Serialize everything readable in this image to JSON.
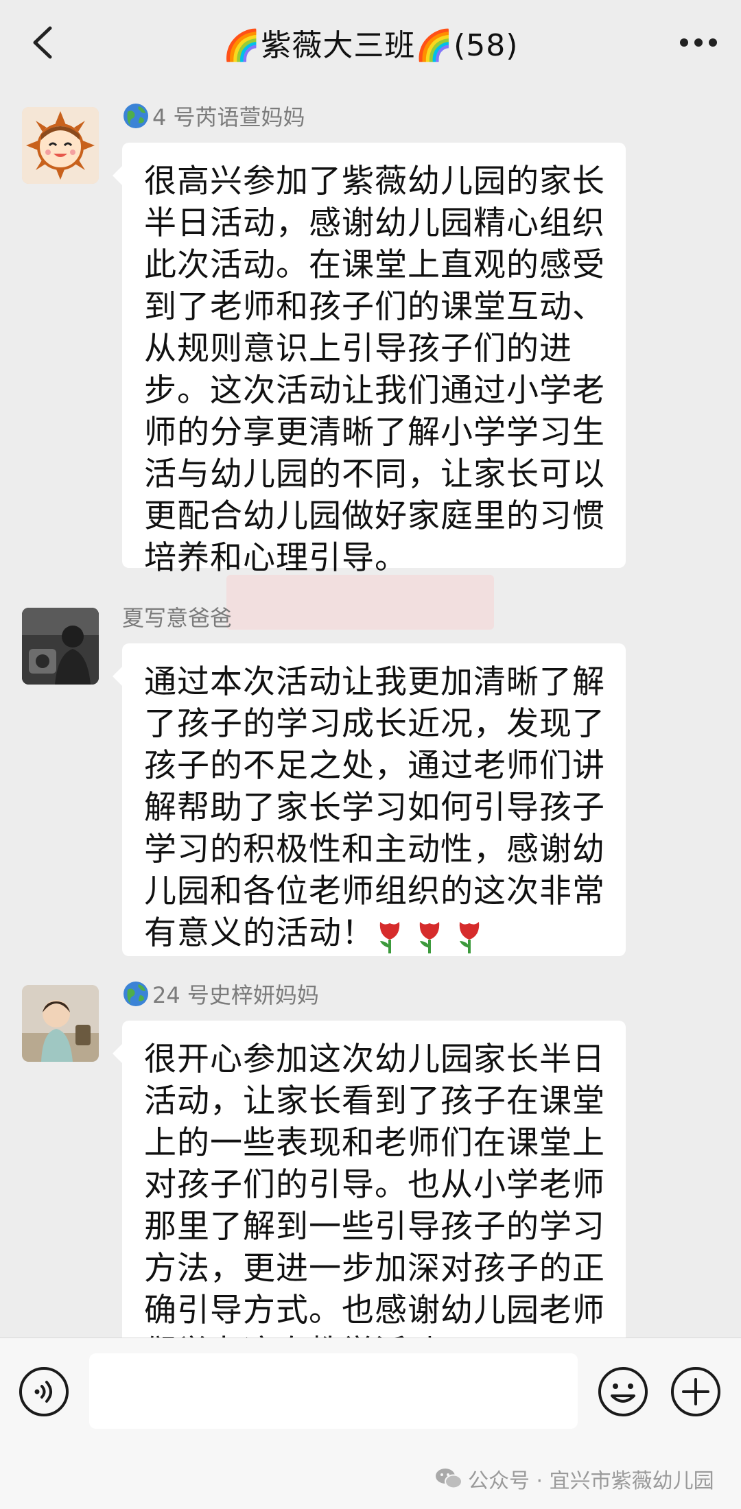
{
  "header": {
    "title": "🌈紫薇大三班🌈(58)"
  },
  "messages": [
    {
      "sender": "4 号芮语萱妈妈",
      "text": "很高兴参加了紫薇幼儿园的家长半日活动，感谢幼儿园精心组织此次活动。在课堂上直观的感受到了老师和孩子们的课堂互动、从规则意识上引导孩子们的进步。这次活动让我们通过小学老师的分享更清晰了解小学学习生活与幼儿园的不同，让家长可以更配合幼儿园做好家庭里的习惯培养和心理引导。"
    },
    {
      "sender": "夏写意爸爸",
      "text": "通过本次活动让我更加清晰了解了孩子的学习成长近况，发现了孩子的不足之处，通过老师们讲解帮助了家长学习如何引导孩子学习的积极性和主动性，感谢幼儿园和各位老师组织的这次非常有意义的活动！"
    },
    {
      "sender": "24 号史梓妍妈妈",
      "text": "很开心参加这次幼儿园家长半日活动，让家长看到了孩子在课堂上的一些表现和老师们在课堂上对孩子们的引导。也从小学老师那里了解到一些引导孩子的学习方法，更进一步加深对孩子的正确引导方式。也感谢幼儿园老师们举办这次教学活动！！"
    }
  ],
  "icons": {
    "back": "chevron-left-icon",
    "more": "more-dots-icon",
    "voice": "voice-icon",
    "emoji": "emoji-icon",
    "plus": "plus-circle-icon",
    "globe": "globe-icon",
    "tulip": "tulip-icon",
    "wechat": "wechat-icon"
  },
  "input": {
    "value": "",
    "placeholder": ""
  },
  "watermark": {
    "text": "公众号 · 宜兴市紫薇幼儿园"
  },
  "colors": {
    "background": "#ededed",
    "bubble": "#ffffff",
    "sender_text": "#7b7b7b",
    "tulip": "#d62b2b"
  }
}
